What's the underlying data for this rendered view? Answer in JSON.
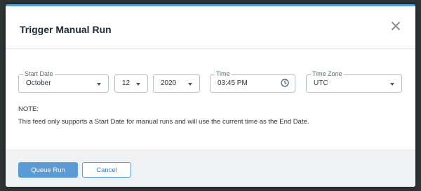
{
  "dialog": {
    "title": "Trigger Manual Run",
    "close_icon": "close-icon"
  },
  "form": {
    "start_date": {
      "legend": "Start Date",
      "month": "October",
      "day": "12",
      "year": "2020"
    },
    "time": {
      "legend": "Time",
      "value": "03:45 PM",
      "icon": "clock-icon"
    },
    "time_zone": {
      "legend": "Time Zone",
      "value": "UTC"
    }
  },
  "note": {
    "label": "NOTE:",
    "text": "This feed only supports a Start Date for manual runs and will use the current time as the End Date."
  },
  "footer": {
    "queue_label": "Queue Run",
    "cancel_label": "Cancel"
  },
  "colors": {
    "accent": "#5b9bd5",
    "footer_bg": "#eff1f3",
    "backdrop": "#2e3436"
  }
}
